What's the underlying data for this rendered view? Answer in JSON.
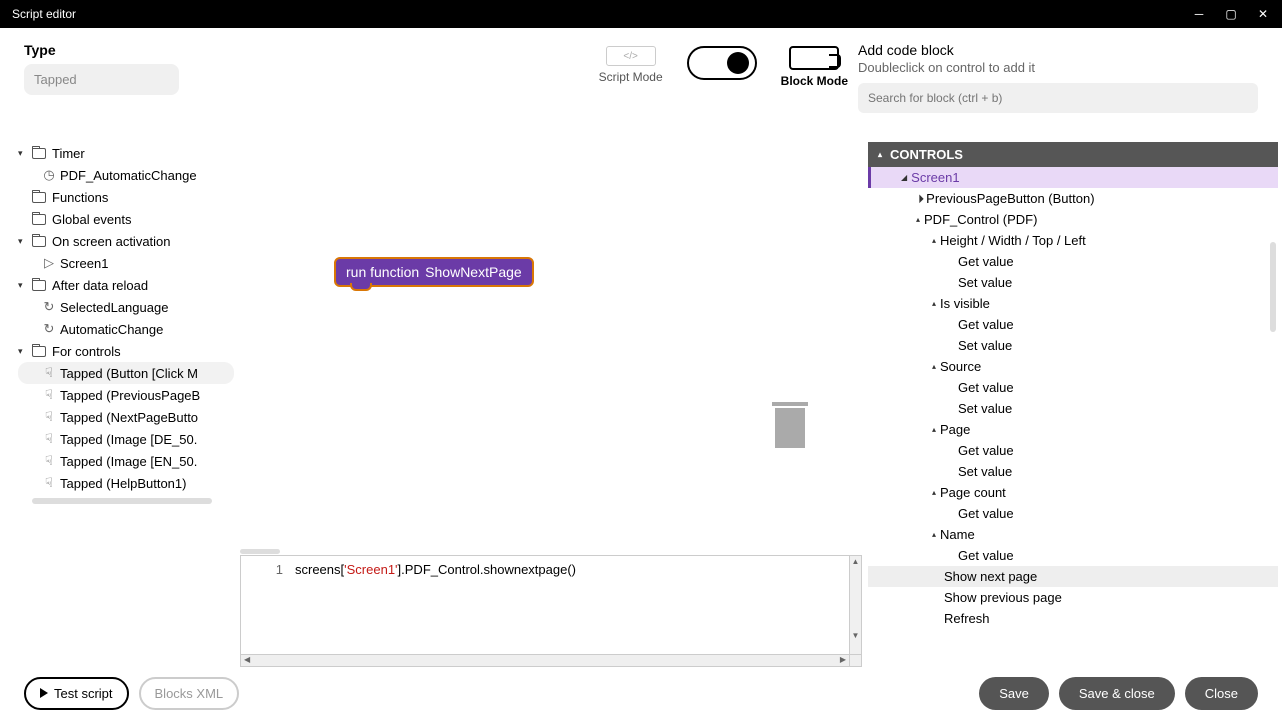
{
  "titlebar": {
    "title": "Script editor"
  },
  "typeSection": {
    "label": "Type",
    "value": "Tapped"
  },
  "modes": {
    "script": "Script Mode",
    "block": "Block Mode"
  },
  "rightHeader": {
    "title": "Add code block",
    "subtitle": "Doubleclick on control to add it",
    "searchPlaceholder": "Search for block (ctrl + b)"
  },
  "tree": {
    "timer": "Timer",
    "pdfAuto": "PDF_AutomaticChange",
    "functions": "Functions",
    "globalEvents": "Global events",
    "onScreen": "On screen activation",
    "screen1": "Screen1",
    "afterReload": "After data reload",
    "selectedLang": "SelectedLanguage",
    "autoChange": "AutomaticChange",
    "forControls": "For controls",
    "tapped1": "Tapped (Button [Click M",
    "tapped2": "Tapped (PreviousPageB",
    "tapped3": "Tapped (NextPageButto",
    "tapped4": "Tapped (Image [DE_50.",
    "tapped5": "Tapped (Image [EN_50.",
    "tapped6": "Tapped (HelpButton1)"
  },
  "block": {
    "runFunction": "run function",
    "fnName": "ShowNextPage"
  },
  "code": {
    "lineNum": "1",
    "pre": "screens[",
    "str": "'Screen1'",
    "post": "].PDF_Control.shownextpage()"
  },
  "controls": {
    "header": "CONTROLS",
    "screen1": "Screen1",
    "prevBtn": "PreviousPageButton (Button)",
    "pdfCtrl": "PDF_Control (PDF)",
    "hwtl": "Height / Width / Top / Left",
    "getValue": "Get value",
    "setValue": "Set value",
    "isVisible": "Is visible",
    "source": "Source",
    "page": "Page",
    "pageCount": "Page count",
    "name": "Name",
    "showNext": "Show next page",
    "showPrev": "Show previous page",
    "refresh": "Refresh"
  },
  "buttons": {
    "test": "Test script",
    "blocksXml": "Blocks XML",
    "save": "Save",
    "saveClose": "Save & close",
    "close": "Close"
  }
}
